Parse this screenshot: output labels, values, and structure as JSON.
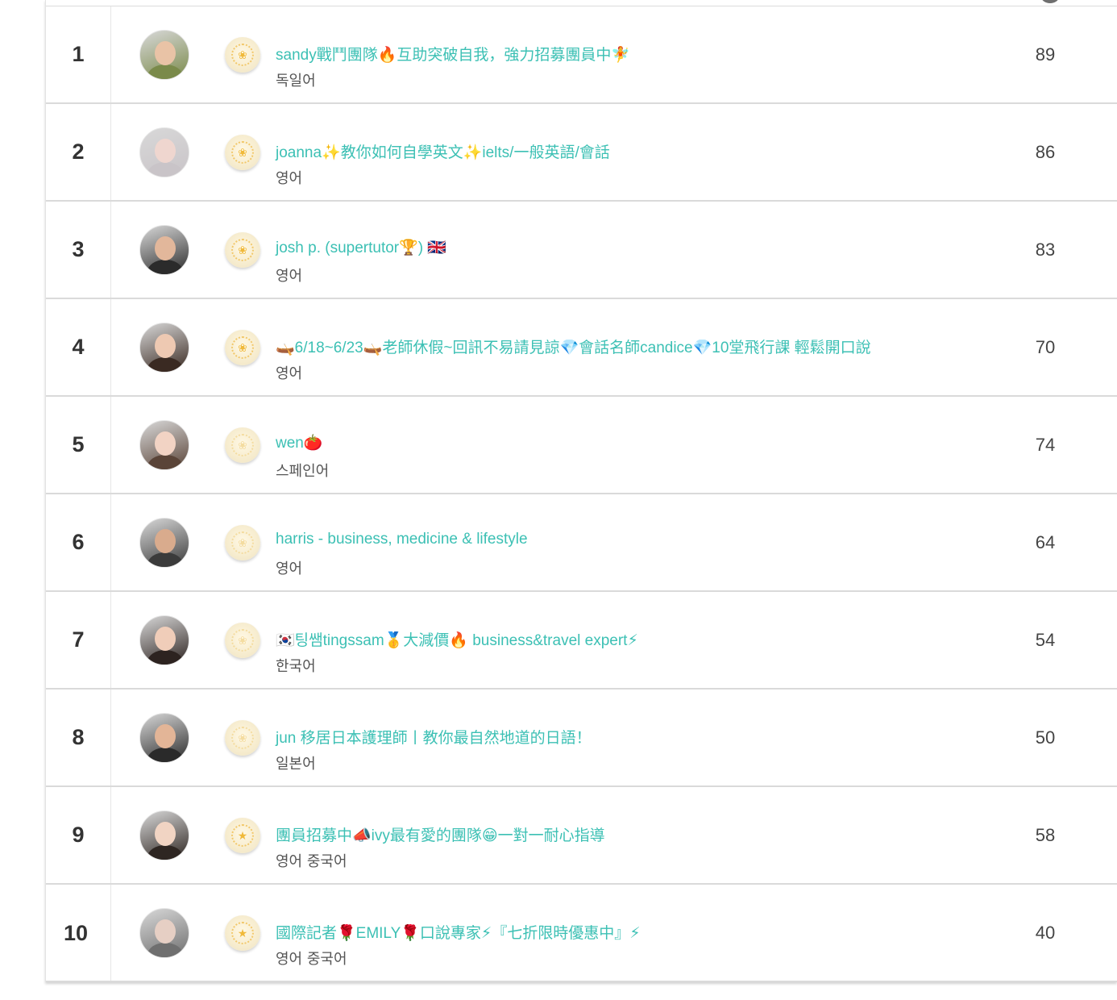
{
  "rows": [
    {
      "rank": "1",
      "name": "sandy戰鬥團隊🔥互助突破自我，強力招募團員中🧚",
      "language": "독일어",
      "score": "89",
      "avatar_color": "#7a8a4a",
      "skin": "#e9c3a6",
      "badge": "gold"
    },
    {
      "rank": "2",
      "name": "joanna✨教你如何自學英文✨ielts/一般英語/會話",
      "language": "영어",
      "score": "86",
      "avatar_color": "#c9c4c8",
      "skin": "#efd6cf",
      "badge": "gold"
    },
    {
      "rank": "3",
      "name": "josh p. (supertutor🏆) 🇬🇧",
      "language": "영어",
      "score": "83",
      "avatar_color": "#2b2b2b",
      "skin": "#e2b79b",
      "badge": "gold"
    },
    {
      "rank": "4",
      "name": "🛶6/18~6/23🛶老師休假~回訊不易請見諒💎會話名師candice💎10堂飛行課 輕鬆開口說",
      "language": "영어",
      "score": "70",
      "avatar_color": "#3a2a22",
      "skin": "#eec9b2",
      "badge": "gold"
    },
    {
      "rank": "5",
      "name": "wen🍅",
      "language": "스페인어",
      "score": "74",
      "avatar_color": "#5a4438",
      "skin": "#f2d3c4",
      "badge": "pale"
    },
    {
      "rank": "6",
      "name": "harris - business, medicine & lifestyle",
      "language": "영어",
      "score": "64",
      "avatar_color": "#3b3b3b",
      "skin": "#d9ab8d",
      "badge": "pale"
    },
    {
      "rank": "7",
      "name": "🇰🇷팅쌤tingssam🥇大減價🔥 business&travel expert⚡",
      "language": "한국어",
      "score": "54",
      "avatar_color": "#2d2320",
      "skin": "#f0cdb9",
      "badge": "pale"
    },
    {
      "rank": "8",
      "name": "jun 移居日本護理師丨教你最自然地道的日語！",
      "language": "일본어",
      "score": "50",
      "avatar_color": "#2a2a2a",
      "skin": "#e3b597",
      "badge": "pale"
    },
    {
      "rank": "9",
      "name": "團員招募中📣ivy最有愛的團隊😁一對一耐心指導",
      "language": "영어 중국어",
      "score": "58",
      "avatar_color": "#2e2622",
      "skin": "#f1d4c3",
      "badge": "star"
    },
    {
      "rank": "10",
      "name": "國際記者🌹EMILY🌹口說專家⚡『七折限時優惠中』⚡",
      "language": "영어 중국어",
      "score": "40",
      "avatar_color": "#6f6f6f",
      "skin": "#e6cfc4",
      "badge": "star"
    }
  ]
}
